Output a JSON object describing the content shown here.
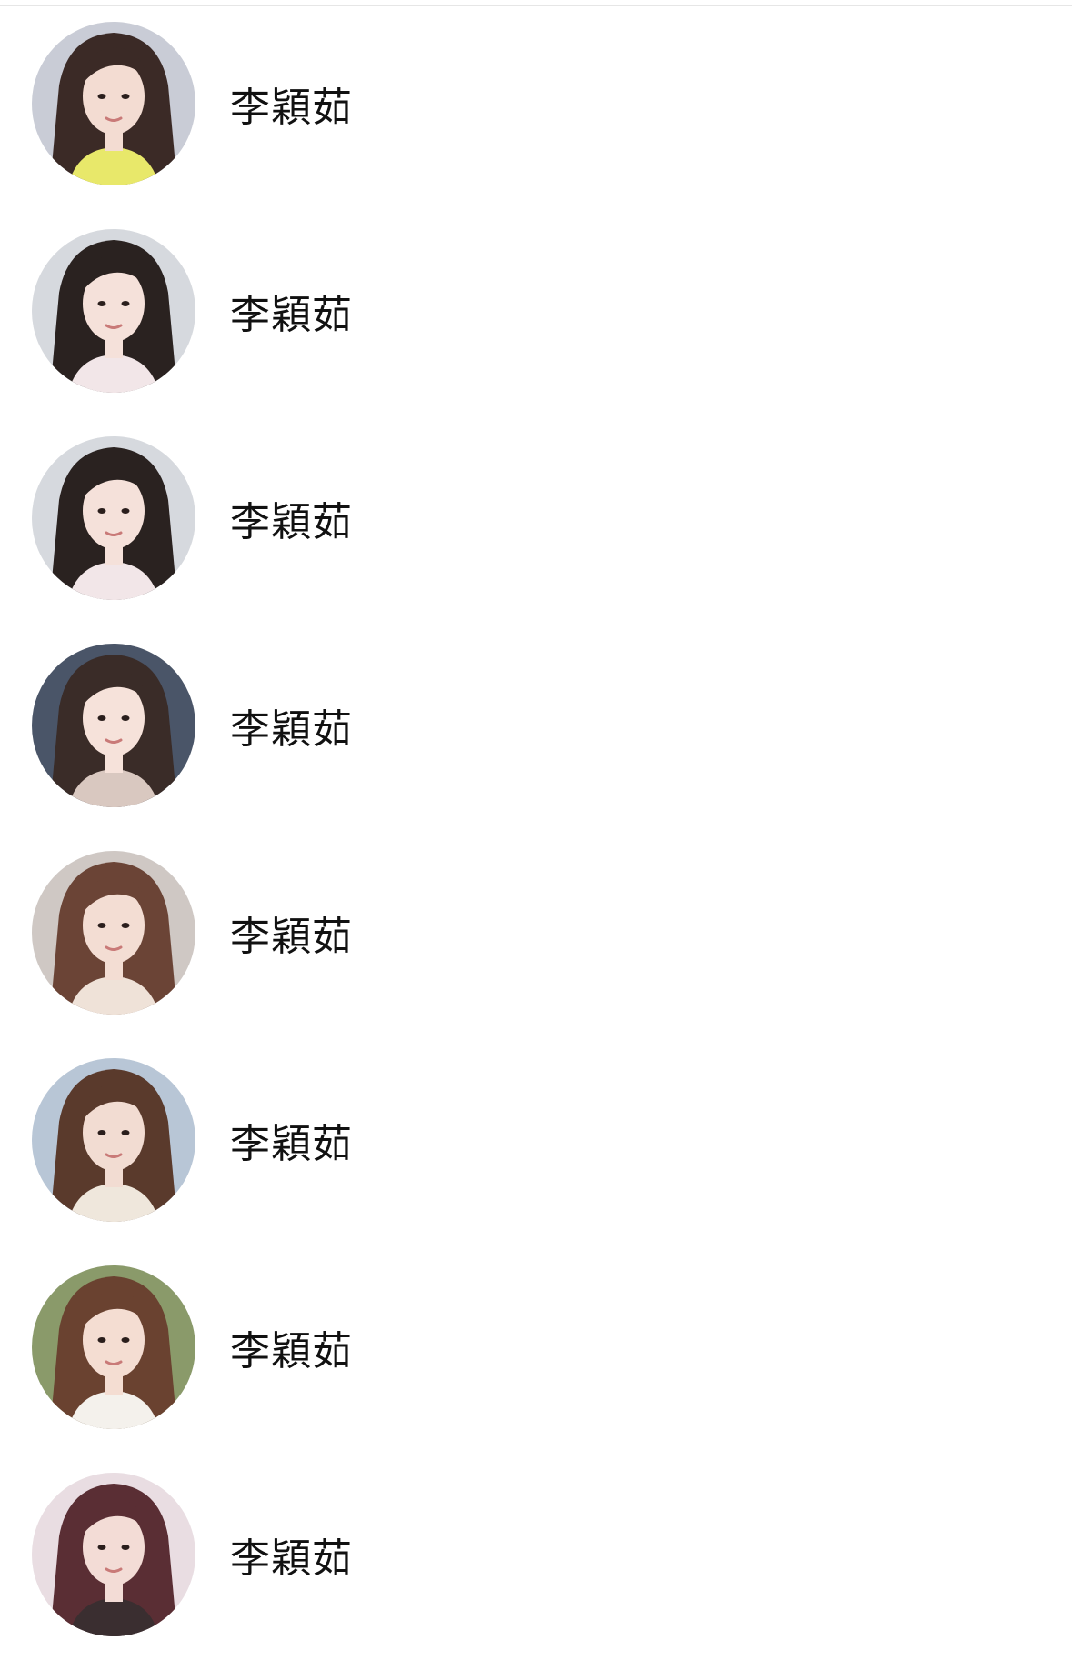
{
  "contacts": [
    {
      "name": "李穎茹",
      "avatar": {
        "bg": "#c9ccd6",
        "hair": "#3b2a26",
        "skin": "#f3dcd2",
        "top": "#e8e86a"
      }
    },
    {
      "name": "李穎茹",
      "avatar": {
        "bg": "#d6d9de",
        "hair": "#2a2220",
        "skin": "#f5e1da",
        "top": "#f2e6e8"
      }
    },
    {
      "name": "李穎茹",
      "avatar": {
        "bg": "#d6d9de",
        "hair": "#2a2220",
        "skin": "#f5e1da",
        "top": "#f2e6e8"
      }
    },
    {
      "name": "李穎茹",
      "avatar": {
        "bg": "#4a5568",
        "hair": "#3a2c28",
        "skin": "#f6e2da",
        "top": "#d9c8c0"
      }
    },
    {
      "name": "李穎茹",
      "avatar": {
        "bg": "#cfc8c4",
        "hair": "#6b4436",
        "skin": "#f3ddd3",
        "top": "#efe2d8"
      }
    },
    {
      "name": "李穎茹",
      "avatar": {
        "bg": "#b8c6d6",
        "hair": "#5a3a2c",
        "skin": "#f2dcd2",
        "top": "#efe7dc"
      }
    },
    {
      "name": "李穎茹",
      "avatar": {
        "bg": "#8a9a6a",
        "hair": "#6a4230",
        "skin": "#f4ddd2",
        "top": "#f4f1ec"
      }
    },
    {
      "name": "李穎茹",
      "avatar": {
        "bg": "#e9dde2",
        "hair": "#5a2e34",
        "skin": "#f3dcd6",
        "top": "#3a2e30"
      }
    }
  ]
}
